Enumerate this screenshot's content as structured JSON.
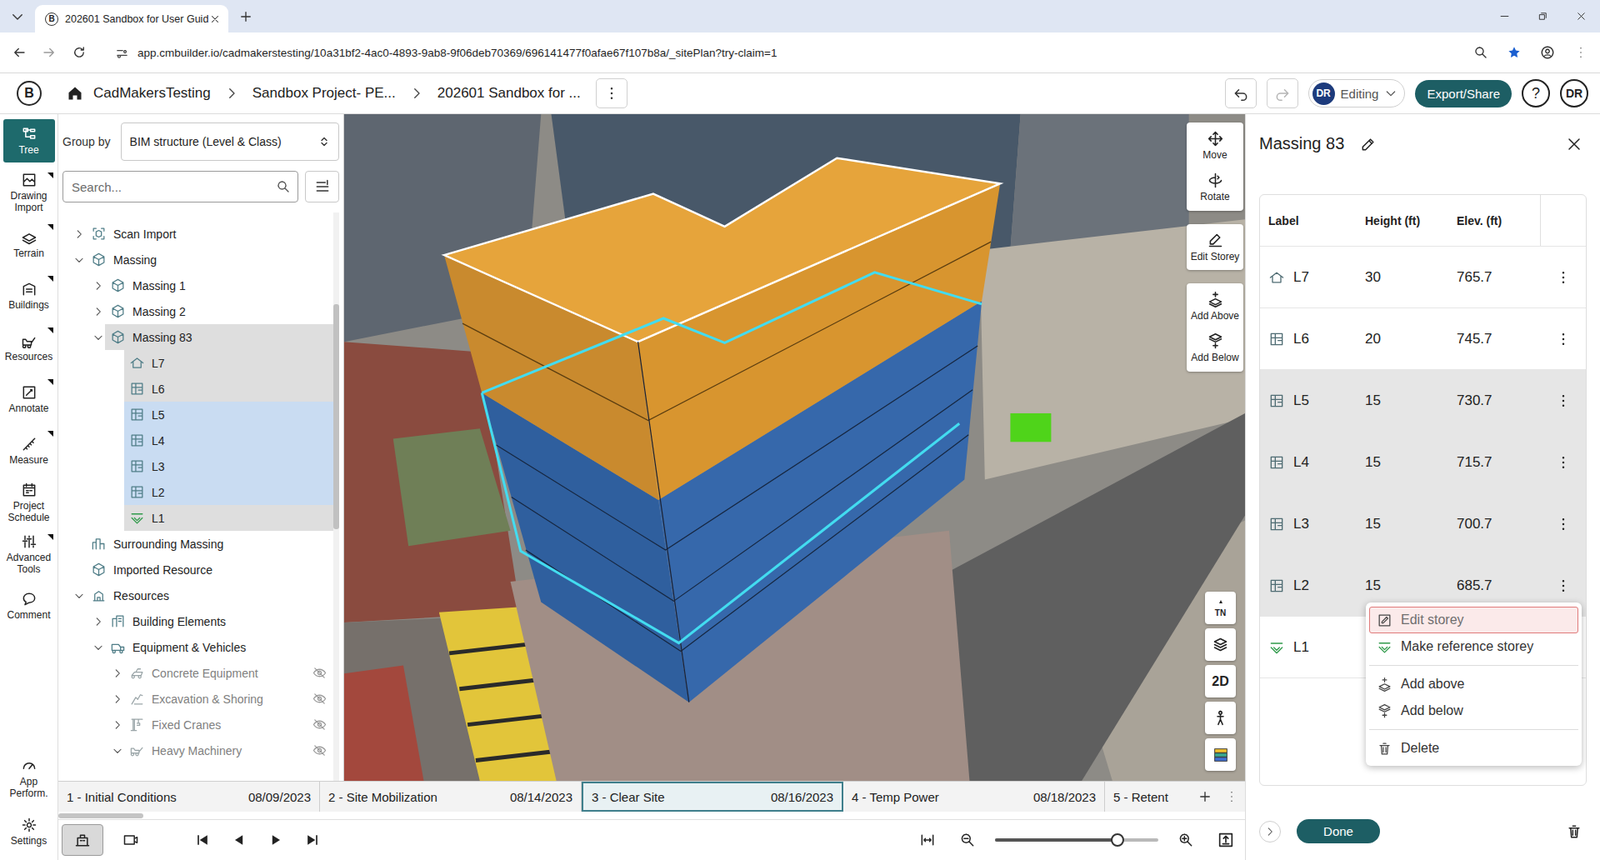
{
  "browser": {
    "tab_title": "202601 Sandbox for User Guid",
    "url": "app.cmbuilder.io/cadmakerstesting/10a31bf2-4ac0-4893-9ab8-9f06deb70369/696141477f0afae67f107b8a/_sitePlan?try-claim=1",
    "bookmarked": true
  },
  "header": {
    "logo": "B",
    "breadcrumbs": [
      "CadMakersTesting",
      "Sandbox Project- PE...",
      "202601 Sandbox for ..."
    ],
    "undo_enabled": true,
    "redo_enabled": false,
    "mode_avatar": "DR",
    "mode_label": "Editing",
    "export_button": "Export/Share",
    "help": "?",
    "user": "DR"
  },
  "rail": {
    "items": [
      {
        "label": "Tree",
        "selected": true,
        "submenu": false
      },
      {
        "label": "Drawing Import",
        "selected": false,
        "submenu": true
      },
      {
        "label": "Terrain",
        "selected": false,
        "submenu": true
      },
      {
        "label": "Buildings",
        "selected": false,
        "submenu": true
      },
      {
        "label": "Resources",
        "selected": false,
        "submenu": true
      },
      {
        "label": "Annotate",
        "selected": false,
        "submenu": true
      },
      {
        "label": "Measure",
        "selected": false,
        "submenu": true
      },
      {
        "label": "Project Schedule",
        "selected": false,
        "submenu": false
      },
      {
        "label": "Advanced Tools",
        "selected": false,
        "submenu": true
      },
      {
        "label": "Comment",
        "selected": false,
        "submenu": false
      }
    ],
    "bottom": [
      {
        "label": "App Perform."
      },
      {
        "label": "Settings"
      }
    ]
  },
  "tree_panel": {
    "group_by_label": "Group by",
    "group_by_value": "BIM structure (Level & Class)",
    "search_placeholder": "Search..."
  },
  "tree": [
    {
      "label": "Scan Import",
      "level": 0,
      "kind": "scan",
      "expandable": true,
      "expanded": false,
      "selected": false,
      "focused": false,
      "hidden": false
    },
    {
      "label": "Massing",
      "level": 0,
      "kind": "massing",
      "expandable": true,
      "expanded": true,
      "selected": false,
      "focused": false,
      "hidden": false
    },
    {
      "label": "Massing 1",
      "level": 1,
      "kind": "massing",
      "expandable": true,
      "expanded": false,
      "selected": false,
      "focused": false,
      "hidden": false
    },
    {
      "label": "Massing 2",
      "level": 1,
      "kind": "massing",
      "expandable": true,
      "expanded": false,
      "selected": false,
      "focused": false,
      "hidden": false
    },
    {
      "label": "Massing 83",
      "level": 1,
      "kind": "massing",
      "expandable": true,
      "expanded": true,
      "selected": false,
      "focused": true,
      "hidden": false
    },
    {
      "label": "L7",
      "level": 2,
      "kind": "roof",
      "expandable": false,
      "expanded": false,
      "selected": false,
      "focused": true,
      "hidden": false
    },
    {
      "label": "L6",
      "level": 2,
      "kind": "storey",
      "expandable": false,
      "expanded": false,
      "selected": false,
      "focused": true,
      "hidden": false
    },
    {
      "label": "L5",
      "level": 2,
      "kind": "storey",
      "expandable": false,
      "expanded": false,
      "selected": true,
      "focused": false,
      "hidden": false
    },
    {
      "label": "L4",
      "level": 2,
      "kind": "storey",
      "expandable": false,
      "expanded": false,
      "selected": true,
      "focused": false,
      "hidden": false
    },
    {
      "label": "L3",
      "level": 2,
      "kind": "storey",
      "expandable": false,
      "expanded": false,
      "selected": true,
      "focused": false,
      "hidden": false
    },
    {
      "label": "L2",
      "level": 2,
      "kind": "storey",
      "expandable": false,
      "expanded": false,
      "selected": true,
      "focused": false,
      "hidden": false
    },
    {
      "label": "L1",
      "level": 2,
      "kind": "reference",
      "expandable": false,
      "expanded": false,
      "selected": false,
      "focused": true,
      "hidden": false
    },
    {
      "label": "Surrounding Massing",
      "level": 0,
      "kind": "surrounding",
      "expandable": false,
      "expanded": false,
      "selected": false,
      "focused": false,
      "hidden": false
    },
    {
      "label": "Imported Resource",
      "level": 0,
      "kind": "imported",
      "expandable": false,
      "expanded": false,
      "selected": false,
      "focused": false,
      "hidden": false
    },
    {
      "label": "Resources",
      "level": 0,
      "kind": "resources",
      "expandable": true,
      "expanded": true,
      "selected": false,
      "focused": false,
      "hidden": false
    },
    {
      "label": "Building Elements",
      "level": 1,
      "kind": "elements",
      "expandable": true,
      "expanded": false,
      "selected": false,
      "focused": false,
      "hidden": false
    },
    {
      "label": "Equipment & Vehicles",
      "level": 1,
      "kind": "equipment",
      "expandable": true,
      "expanded": true,
      "selected": false,
      "focused": false,
      "hidden": false
    },
    {
      "label": "Concrete Equipment",
      "level": 2,
      "kind": "concrete",
      "expandable": true,
      "expanded": false,
      "selected": false,
      "focused": false,
      "hidden": true
    },
    {
      "label": "Excavation & Shoring",
      "level": 2,
      "kind": "excavation",
      "expandable": true,
      "expanded": false,
      "selected": false,
      "focused": false,
      "hidden": true
    },
    {
      "label": "Fixed Cranes",
      "level": 2,
      "kind": "crane",
      "expandable": true,
      "expanded": false,
      "selected": false,
      "focused": false,
      "hidden": true
    },
    {
      "label": "Heavy Machinery",
      "level": 2,
      "kind": "machinery",
      "expandable": true,
      "expanded": true,
      "selected": false,
      "focused": false,
      "hidden": true
    }
  ],
  "viewport": {
    "tool_groups": [
      [
        {
          "label": "Move"
        },
        {
          "label": "Rotate"
        }
      ],
      [
        {
          "label": "Edit Storey"
        }
      ],
      [
        {
          "label": "Add Above"
        },
        {
          "label": "Add Below"
        }
      ]
    ],
    "compass_label": "TN",
    "view_2d": "2D"
  },
  "timeline": {
    "phases": [
      {
        "label": "1 - Initial Conditions",
        "date": "08/09/2023",
        "selected": false
      },
      {
        "label": "2 - Site Mobilization",
        "date": "08/14/2023",
        "selected": false
      },
      {
        "label": "3 - Clear Site",
        "date": "08/16/2023",
        "selected": true
      },
      {
        "label": "4 - Temp Power",
        "date": "08/18/2023",
        "selected": false
      },
      {
        "label": "5 - Retent",
        "selected": false
      }
    ]
  },
  "bottom_toolbar": {
    "view_modes": [
      {
        "selected": true
      },
      {
        "selected": false
      }
    ],
    "zoom_level": 0.75
  },
  "storey_panel": {
    "title": "Massing 83",
    "columns": [
      "Label",
      "Height (ft)",
      "Elev. (ft)"
    ],
    "rows": [
      {
        "label": "L7",
        "height": "30",
        "elevation": "765.7",
        "kind": "roof",
        "selected": false
      },
      {
        "label": "L6",
        "height": "20",
        "elevation": "745.7",
        "kind": "storey",
        "selected": false
      },
      {
        "label": "L5",
        "height": "15",
        "elevation": "730.7",
        "kind": "storey",
        "selected": true
      },
      {
        "label": "L4",
        "height": "15",
        "elevation": "715.7",
        "kind": "storey",
        "selected": true
      },
      {
        "label": "L3",
        "height": "15",
        "elevation": "700.7",
        "kind": "storey",
        "selected": true
      },
      {
        "label": "L2",
        "height": "15",
        "elevation": "685.7",
        "kind": "storey",
        "selected": true
      },
      {
        "label": "L1",
        "height": "",
        "elevation": "",
        "kind": "reference",
        "selected": false
      }
    ],
    "done_button": "Done"
  },
  "context_menu": {
    "groups": [
      [
        {
          "label": "Edit storey",
          "highlighted": true
        },
        {
          "label": "Make reference storey",
          "highlighted": false
        }
      ],
      [
        {
          "label": "Add above",
          "highlighted": false
        },
        {
          "label": "Add below",
          "highlighted": false
        }
      ],
      [
        {
          "label": "Delete",
          "highlighted": false
        }
      ]
    ]
  }
}
